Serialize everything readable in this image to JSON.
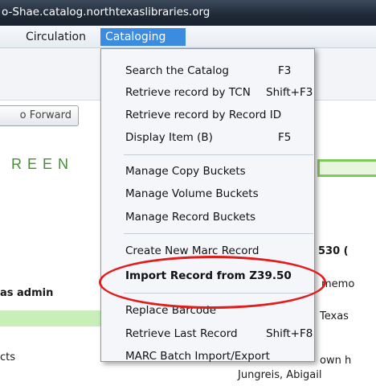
{
  "window": {
    "title": "o-Shae.catalog.northtexaslibraries.org"
  },
  "menubar": {
    "items": [
      {
        "label": "Circulation",
        "accel": "C",
        "rest": "irculation",
        "active": false
      },
      {
        "label": "Cataloging",
        "accel": "C",
        "rest": "ataloging",
        "active": true
      }
    ]
  },
  "background": {
    "forward_button": "o Forward",
    "logo": "REEN",
    "user_label": "as admin",
    "row_fragment": "cts",
    "right_530": "530  (",
    "right_memo": "memo",
    "right_texas": "Texas",
    "right_own": "own h",
    "patron_name": "Jungreis, Abigail"
  },
  "dropdown": {
    "items": [
      {
        "label": "Search the Catalog",
        "shortcut": "F3"
      },
      {
        "label": "Retrieve record by TCN",
        "shortcut": "Shift+F3"
      },
      {
        "label": "Retrieve record by Record ID",
        "shortcut": ""
      },
      {
        "label": "Display Item (B)",
        "shortcut": "F5"
      },
      {
        "label": "Manage Copy Buckets",
        "shortcut": ""
      },
      {
        "label": "Manage Volume Buckets",
        "shortcut": ""
      },
      {
        "label": "Manage Record Buckets",
        "shortcut": ""
      },
      {
        "label": "Create New Marc Record",
        "shortcut": ""
      },
      {
        "label": "Import Record from Z39.50",
        "shortcut": ""
      },
      {
        "label": "Replace Barcode",
        "shortcut": ""
      },
      {
        "label": "Retrieve Last Record",
        "shortcut": "Shift+F8"
      },
      {
        "label": "MARC Batch Import/Export",
        "shortcut": ""
      }
    ]
  },
  "annotation": {
    "color": "#e21b1b"
  },
  "colors": {
    "accent": "#3b8be0",
    "green": "#7fc85a"
  }
}
